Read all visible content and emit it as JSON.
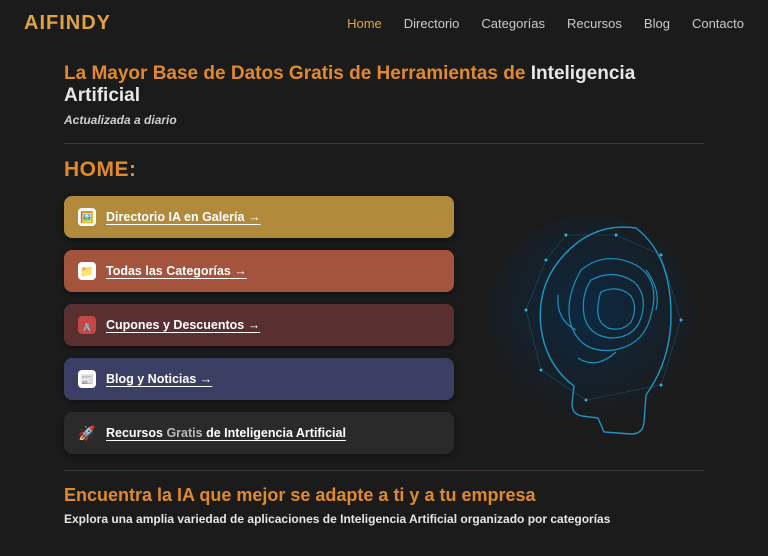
{
  "header": {
    "logo": "AIFINDY",
    "nav": [
      "Home",
      "Directorio",
      "Categorías",
      "Recursos",
      "Blog",
      "Contacto"
    ]
  },
  "hero": {
    "headline_pre": "La Mayor Base de Datos Gratis de Herramientas de ",
    "headline_em": "Inteligencia Artificial",
    "tagline": "Actualizada a diario"
  },
  "home": {
    "title": "HOME:",
    "buttons": [
      {
        "icon": "🖼️",
        "label": "Directorio IA en Galería →"
      },
      {
        "icon": "📁",
        "label": "Todas las Categorías →"
      },
      {
        "icon": "✂️",
        "label": "Cupones y Descuentos →"
      },
      {
        "icon": "📰",
        "label": "Blog y Noticias →"
      },
      {
        "icon": "🚀",
        "label_pre": "Recursos ",
        "label_mid": "Gratis",
        "label_post": " de Inteligencia Artificial"
      }
    ]
  },
  "find": {
    "title": "Encuentra la IA que mejor se adapte a ti y a tu empresa",
    "subtitle": "Explora una amplia variedad de aplicaciones de Inteligencia Artificial organizado por categorías"
  }
}
